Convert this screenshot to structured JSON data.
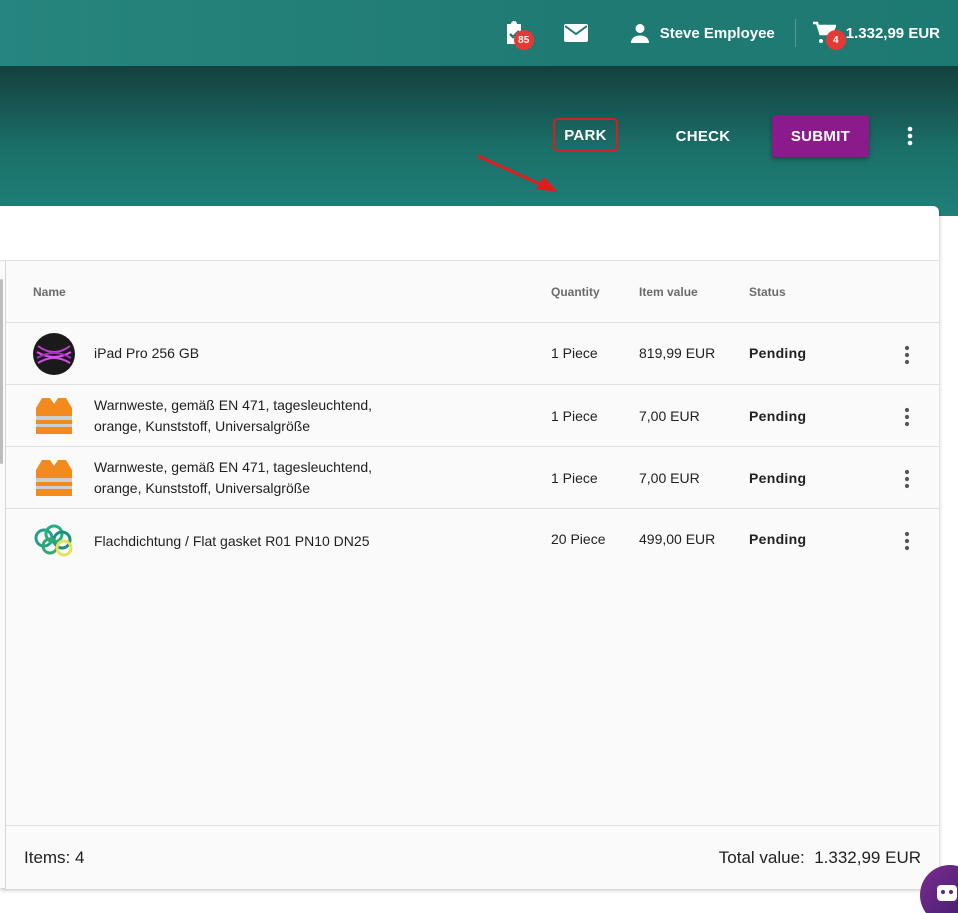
{
  "topbar": {
    "tasks_badge": "85",
    "user_name": "Steve Employee",
    "cart_badge": "4",
    "cart_value": "1.332,99 EUR",
    "icons": [
      "clipboard-check-icon",
      "mail-icon",
      "user-icon",
      "cart-icon"
    ]
  },
  "actions": {
    "park": "PARK",
    "check": "CHECK",
    "submit": "SUBMIT"
  },
  "colors": {
    "topbar": "#1f7a73",
    "submit": "#8b1a8a",
    "highlight": "#d32121",
    "badge": "#e53935"
  },
  "table": {
    "headers": {
      "name": "Name",
      "quantity": "Quantity",
      "item_value": "Item value",
      "status": "Status"
    },
    "rows": [
      {
        "name": "iPad Pro 256 GB",
        "quantity": "1 Piece",
        "item_value": "819,99 EUR",
        "status": "Pending",
        "thumb": "ipad-thumb"
      },
      {
        "name": "Warnweste, gemäß EN 471, tagesleuchtend, orange, Kunststoff, Universalgröße",
        "quantity": "1 Piece",
        "item_value": "7,00 EUR",
        "status": "Pending",
        "thumb": "vest-thumb"
      },
      {
        "name": "Warnweste, gemäß EN 471, tagesleuchtend, orange, Kunststoff, Universalgröße",
        "quantity": "1 Piece",
        "item_value": "7,00 EUR",
        "status": "Pending",
        "thumb": "vest-thumb"
      },
      {
        "name": "Flachdichtung / Flat gasket R01 PN10 DN25",
        "quantity": "20 Piece",
        "item_value": "499,00 EUR",
        "status": "Pending",
        "thumb": "gasket-thumb"
      }
    ]
  },
  "footer": {
    "items_label": "Items: 4",
    "total_label": "Total value:  1.332,99 EUR"
  }
}
